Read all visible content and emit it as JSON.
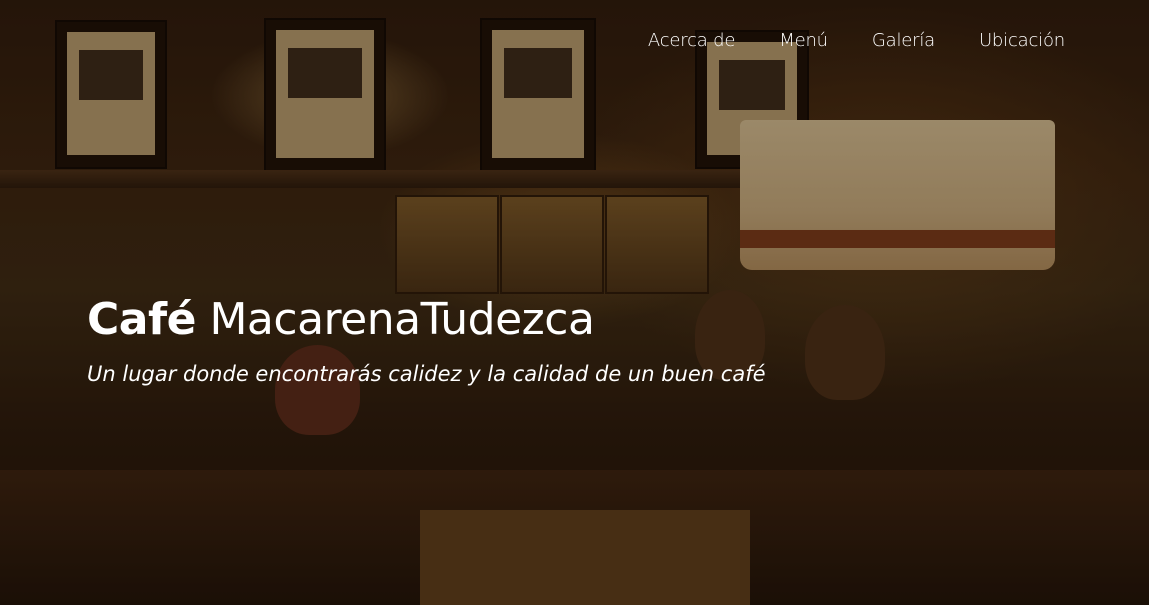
{
  "nav": {
    "items": [
      {
        "label": "Acerca de"
      },
      {
        "label": "Menú"
      },
      {
        "label": "Galería"
      },
      {
        "label": "Ubicación"
      }
    ]
  },
  "hero": {
    "title_bold": "Café",
    "title_light": "MacarenaTudezca",
    "subtitle": "Un lugar donde encontrarás calidez y la calidad de un buen café",
    "background_image": "cafe-interior-photo"
  },
  "colors": {
    "text": "#ffffff",
    "overlay_tint": "#2a1608"
  }
}
